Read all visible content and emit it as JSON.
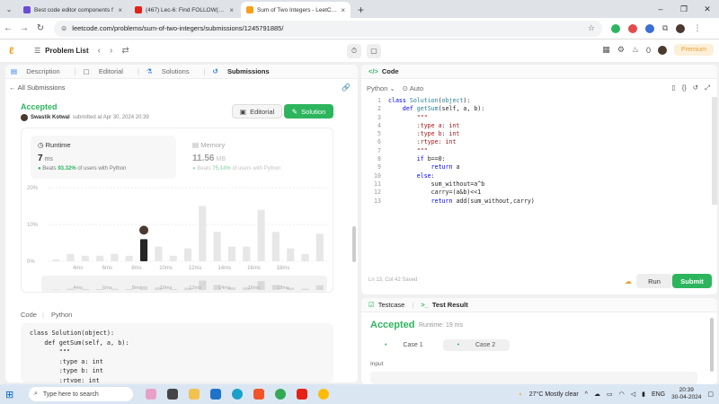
{
  "browser": {
    "tabs": [
      {
        "label": "Best code editor components f",
        "favcolor": "#6a4bd8",
        "active": false
      },
      {
        "label": "(467) Lec-6: Find FOLLOW() in C",
        "favcolor": "#e62117",
        "active": false
      },
      {
        "label": "Sum of Two Integers - LeetCod",
        "favcolor": "#f89f1b",
        "active": true
      }
    ],
    "new_tab": "+",
    "url": "leetcode.com/problems/sum-of-two-integers/submissions/1245791885/"
  },
  "header": {
    "problem_list": "Problem List",
    "coins": "0",
    "premium": "Premium"
  },
  "left": {
    "tabs": [
      {
        "label": "Description",
        "active": false
      },
      {
        "label": "Editorial",
        "active": false
      },
      {
        "label": "Solutions",
        "active": false
      },
      {
        "label": "Submissions",
        "active": true
      }
    ],
    "all_submissions": "All Submissions",
    "status": "Accepted",
    "submitter": "Swastik Kotwal",
    "submitted_text": "submitted at Apr 30, 2024 20:39",
    "editorial_btn": "Editorial",
    "solution_btn": "Solution",
    "runtime": {
      "label": "Runtime",
      "value": "7",
      "unit": "ms",
      "beats_prefix": "Beats",
      "beats": "93.32%",
      "beats_suffix": "of users with Python"
    },
    "memory": {
      "label": "Memory",
      "value": "11.56",
      "unit": "MB",
      "beats_prefix": "Beats",
      "beats": "75.14%",
      "beats_suffix": "of users with Python"
    },
    "code_label": "Code",
    "code_lang": "Python",
    "code_snippet": "class Solution(object):\n    def getSum(self, a, b):\n        \"\"\"\n        :type a: int\n        :type b: int\n        :rtype: int"
  },
  "chart_data": {
    "type": "bar",
    "title": "",
    "ylabel": "",
    "yticks": [
      "20%",
      "10%",
      "0%"
    ],
    "ylim": [
      0,
      20
    ],
    "xticks": [
      "4ms",
      "6ms",
      "8ms",
      "10ms",
      "12ms",
      "14ms",
      "16ms",
      "18ms"
    ],
    "values": [
      0.5,
      2,
      1.5,
      1.5,
      2,
      1.5,
      6,
      4,
      1.5,
      3.5,
      15,
      8,
      4,
      4,
      14,
      8,
      3.5,
      2,
      7.5
    ],
    "highlight_index": 6,
    "bar_color": "#e7e7e7",
    "highlight_color": "#262626"
  },
  "right": {
    "code_title": "Code",
    "language": "Python",
    "auto": "Auto",
    "line_numbers": [
      "1",
      "2",
      "3",
      "4",
      "5",
      "6",
      "7",
      "8",
      "9",
      "10",
      "11",
      "12",
      "13"
    ],
    "status": "Ln 13, Col 42   Saved",
    "run": "Run",
    "submit": "Submit"
  },
  "result": {
    "tab_testcase": "Testcase",
    "tab_result": "Test Result",
    "status": "Accepted",
    "runtime": "Runtime: 19 ms",
    "case1": "Case 1",
    "case2": "Case 2",
    "input_label": "Input"
  },
  "taskbar": {
    "search": "Type here to search",
    "weather": "27°C  Mostly clear",
    "lang": "ENG",
    "time": "20:39",
    "date": "30-04-2024"
  }
}
